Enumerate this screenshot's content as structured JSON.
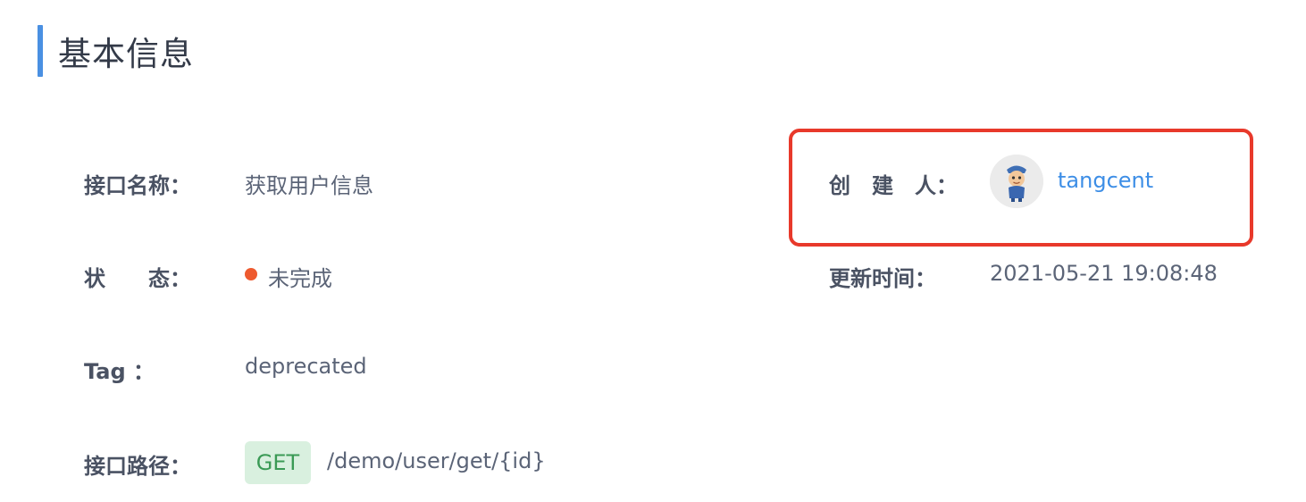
{
  "section": {
    "title": "基本信息"
  },
  "fields": {
    "api_name": {
      "label": "接口名称：",
      "value": "获取用户信息"
    },
    "status": {
      "label": "状　　态：",
      "value": "未完成",
      "dot_color": "#ee5a2f"
    },
    "tag": {
      "label": "Tag ：",
      "value": "deprecated"
    },
    "path": {
      "label": "接口路径：",
      "method": "GET",
      "value": "/demo/user/get/{id}"
    },
    "creator": {
      "label": "创　建　人：",
      "value": "tangcent",
      "avatar": "cartoon-avatar-icon"
    },
    "updated": {
      "label": "更新时间：",
      "value": "2021-05-21 19:08:48"
    }
  },
  "colors": {
    "accent": "#4a90e2",
    "highlight_border": "#e8392b",
    "link": "#3d8ee6",
    "get_badge_bg": "#d9f0df",
    "get_badge_text": "#3a9a55"
  }
}
